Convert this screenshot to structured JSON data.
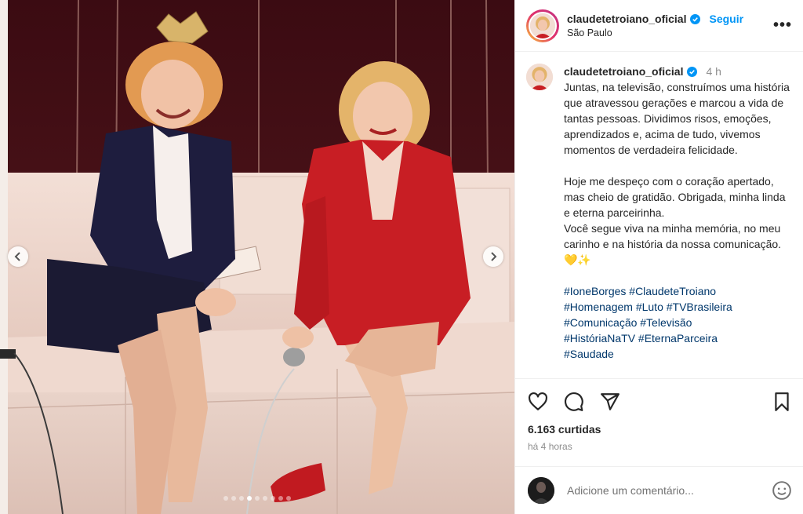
{
  "account": {
    "username": "claudetetroiano_oficial",
    "follow_label": "Seguir",
    "location": "São Paulo",
    "more_label": "•••"
  },
  "caption": {
    "username": "claudetetroiano_oficial",
    "time": "4 h",
    "paragraph1": "Juntas, na televisão, construímos uma história que atravessou gerações e marcou a vida de tantas pessoas. Dividimos risos, emoções, aprendizados e, acima de tudo, vivemos momentos de verdadeira felicidade.",
    "paragraph2": "Hoje me despeço com o coração apertado, mas cheio de gratidão. Obrigada, minha linda e eterna parceirinha.",
    "paragraph3": "Você segue viva na minha memória, no meu carinho e na história da nossa comunicação. 💛✨",
    "hashtags_line1": "#IoneBorges #ClaudeteTroiano",
    "hashtags_line2": "#Homenagem #Luto #TVBrasileira",
    "hashtags_line3": "#Comunicação #Televisão",
    "hashtags_line4": "#HistóriaNaTV #EternaParceira",
    "hashtags_line5": "#Saudade"
  },
  "stats": {
    "likes": "6.163 curtidas",
    "posted": "há 4 horas"
  },
  "comment": {
    "placeholder": "Adicione um comentário..."
  },
  "carousel": {
    "slide_count": 9,
    "active_index": 3
  },
  "colors": {
    "link": "#0095f6",
    "hashtag": "#00376b",
    "verified": "#0095f6",
    "red_blazer": "#c81e24",
    "navy_blazer": "#1e1d3e"
  },
  "icons": [
    "heart-icon",
    "comment-icon",
    "share-icon",
    "bookmark-icon",
    "emoji-icon",
    "verified-icon",
    "chevron-left-icon",
    "chevron-right-icon"
  ]
}
